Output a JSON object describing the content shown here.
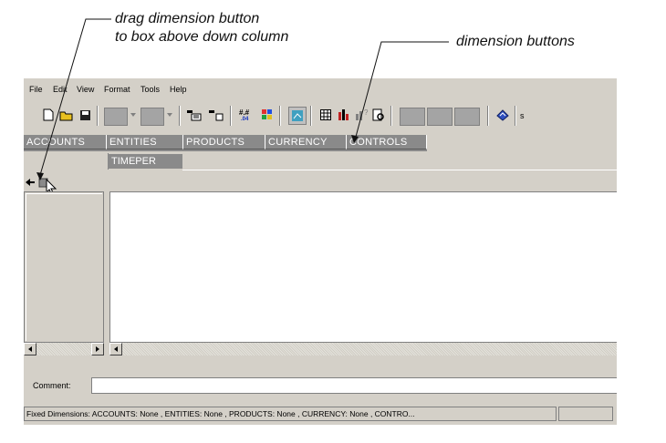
{
  "annotations": {
    "drag_line1": "drag dimension button",
    "drag_line2": "to box above down column",
    "dim_buttons": "dimension buttons"
  },
  "menu": [
    "File",
    "Edit",
    "View",
    "Format",
    "Tools",
    "Help"
  ],
  "toolbar": {
    "icons": [
      "new-doc-icon",
      "open-folder-icon",
      "save-icon",
      "grey-color-block",
      "grey-color-block",
      "pivot-icon",
      "swap-icon",
      "number-format-icon",
      "color-grid-icon",
      "chart-view-icon",
      "table-icon",
      "bar-chart-icon",
      "chart-help-icon",
      "print-preview-icon",
      "book-icon"
    ],
    "trailing_letter": "s"
  },
  "dimensions": [
    {
      "label": "ACCOUNTS"
    },
    {
      "label": "ENTITIES"
    },
    {
      "label": "PRODUCTS"
    },
    {
      "label": "CURRENCY"
    },
    {
      "label": "CONTROLS"
    }
  ],
  "row_dimension": "TIMEPER",
  "comment": {
    "label": "Comment:",
    "value": ""
  },
  "status": {
    "text": "Fixed Dimensions: ACCOUNTS: None , ENTITIES: None , PRODUCTS: None , CURRENCY: None , CONTRO..."
  },
  "colors": {
    "dim_button": "#8a8a8a",
    "window": "#d4d0c8",
    "grid": "#ffffff"
  }
}
